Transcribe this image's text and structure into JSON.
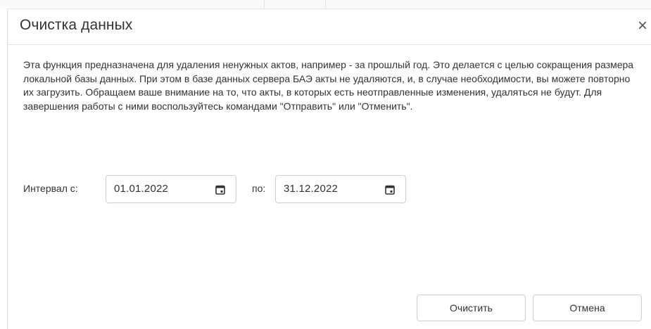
{
  "dialog": {
    "title": "Очистка данных",
    "close_glyph": "×",
    "description": "Эта функция предназначена для удаления ненужных актов, например - за прошлый год. Это делается с целью сокращения размера локальной базы данных. При этом в базе данных сервера БАЭ акты не удаляются, и, в случае необходимости, вы можете повторно их загрузить. Обращаем ваше внимание на то, что акты, в которых есть неотправленные изменения, удаляться не будут. Для завершения работы с ними воспользуйтесь командами \"Отправить\" или \"Отменить\".",
    "interval": {
      "from_label": "Интервал с:",
      "from_value": "01.01.2022",
      "to_label": "по:",
      "to_value": "31.12.2022"
    },
    "buttons": {
      "clear_label": "Очистить",
      "cancel_label": "Отмена"
    }
  },
  "icons": {
    "close": "close-icon",
    "calendar": "calendar-icon"
  },
  "colors": {
    "text": "#333333",
    "border": "#cfcfcf",
    "divider": "#e5e5e5"
  }
}
